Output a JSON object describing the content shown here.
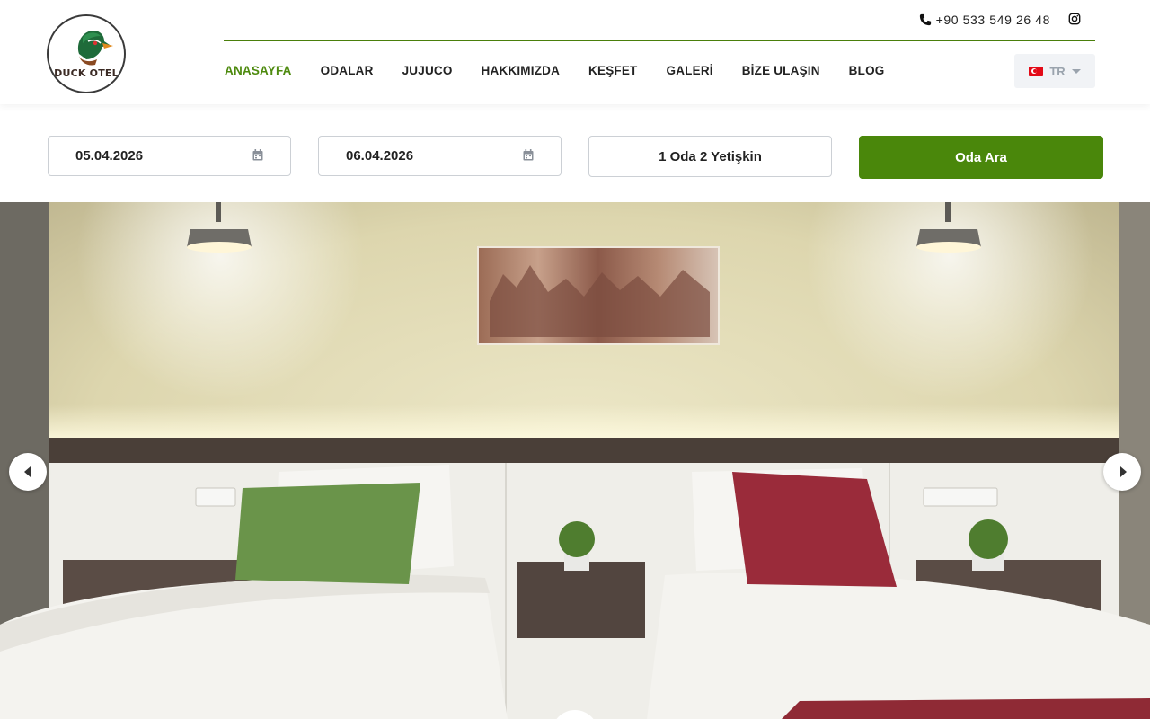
{
  "brand": {
    "logo_text": "DUCK OTEL"
  },
  "topbar": {
    "phone": "+90 533 549 26 48"
  },
  "nav": {
    "items": [
      {
        "label": "ANASAYFA",
        "active": true
      },
      {
        "label": "ODALAR"
      },
      {
        "label": "JUJUCO"
      },
      {
        "label": "HAKKIMIZDA"
      },
      {
        "label": "KEŞFET"
      },
      {
        "label": "GALERİ"
      },
      {
        "label": "BİZE ULAŞIN"
      },
      {
        "label": "BLOG"
      }
    ]
  },
  "language": {
    "selected": "TR"
  },
  "booking": {
    "checkin": "05.04.2026",
    "checkout": "06.04.2026",
    "guests": "1 Oda 2 Yetişkin",
    "search_label": "Oda Ara"
  },
  "colors": {
    "accent": "#4a870b",
    "nav_active": "#4d8a0e"
  },
  "icons": {
    "phone": "phone-icon",
    "social": "instagram-icon",
    "calendar": "calendar-icon",
    "prev": "chevron-left-icon",
    "next": "chevron-right-icon"
  }
}
